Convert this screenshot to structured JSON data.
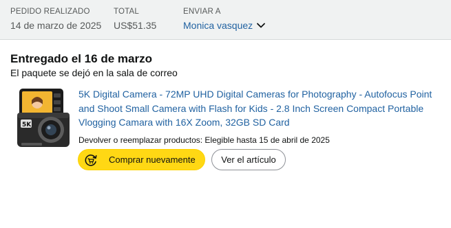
{
  "order_header": {
    "placed_label": "PEDIDO REALIZADO",
    "placed_value": "14 de marzo de 2025",
    "total_label": "TOTAL",
    "total_value": "US$51.35",
    "ship_label": "ENVIAR A",
    "ship_value": "Monica vasquez"
  },
  "delivery": {
    "title": "Entregado el 16 de marzo",
    "subtitle": "El paquete se dejó en la sala de correo"
  },
  "product": {
    "title": "5K Digital Camera - 72MP UHD Digital Cameras for Photography - Autofocus Point and Shoot Small Camera with Flash for Kids - 2.8 Inch Screen Compact Portable Vlogging Camara with 16X Zoom, 32GB SD Card",
    "return_note": "Devolver o reemplazar productos: Elegible hasta 15 de abril de 2025",
    "thumbnail_icon": "camera-product-image",
    "thumbnail_text": "5K"
  },
  "actions": {
    "buy_again_label": "Comprar nuevamente",
    "buy_again_icon": "buy-again-icon",
    "view_item_label": "Ver el artículo"
  },
  "colors": {
    "header_bg": "#f0f2f2",
    "link": "#2162a1",
    "buy_button": "#ffd814"
  }
}
